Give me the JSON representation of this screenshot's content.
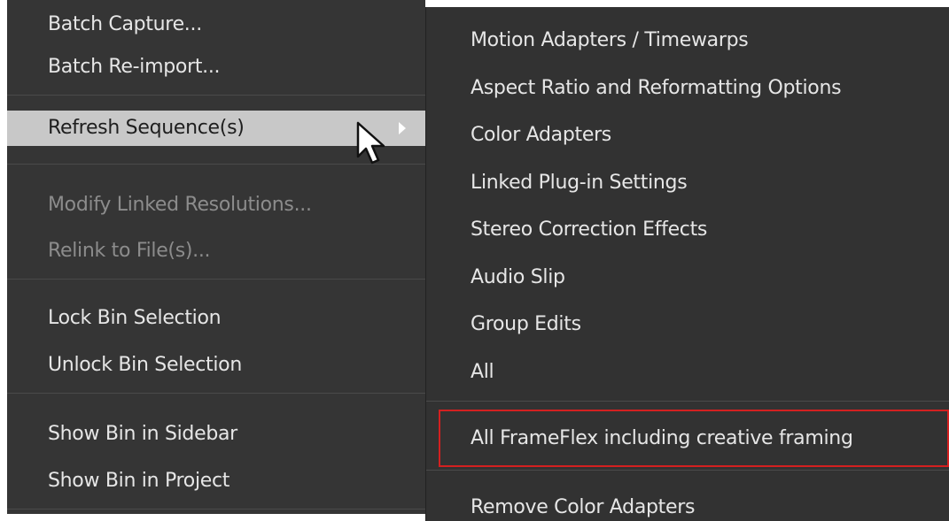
{
  "main_menu": {
    "items": [
      {
        "label": "Batch Capture...",
        "enabled": true
      },
      {
        "label": "Batch Re-import...",
        "enabled": true
      },
      {
        "label": "Refresh Sequence(s)",
        "enabled": true,
        "highlighted": true,
        "has_submenu": true
      },
      {
        "label": "Modify Linked Resolutions...",
        "enabled": false
      },
      {
        "label": "Relink to File(s)...",
        "enabled": false
      },
      {
        "label": "Lock Bin Selection",
        "enabled": true
      },
      {
        "label": "Unlock Bin Selection",
        "enabled": true
      },
      {
        "label": "Show Bin in Sidebar",
        "enabled": true
      },
      {
        "label": "Show Bin in Project",
        "enabled": true
      }
    ]
  },
  "submenu": {
    "items": [
      {
        "label": "Motion Adapters / Timewarps"
      },
      {
        "label": "Aspect Ratio and Reformatting Options"
      },
      {
        "label": "Color Adapters"
      },
      {
        "label": "Linked Plug-in Settings"
      },
      {
        "label": "Stereo Correction Effects"
      },
      {
        "label": "Audio Slip"
      },
      {
        "label": "Group Edits"
      },
      {
        "label": "All"
      },
      {
        "label": "All FrameFlex including creative framing",
        "outlined": true
      },
      {
        "label": "Remove Color Adapters"
      }
    ]
  },
  "colors": {
    "menu_bg": "#353535",
    "highlight_bg": "#c8c8c8",
    "callout_border": "#d42020"
  },
  "icons": {
    "submenu_arrow": "chevron-right-icon",
    "pointer": "mouse-cursor-icon"
  }
}
